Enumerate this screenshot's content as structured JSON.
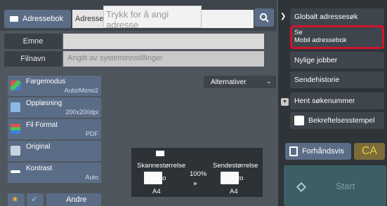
{
  "topbar": {
    "addressbook_label": "Adressebok",
    "address_tag": "Adresse",
    "address_placeholder": "Trykk for å angi adresse"
  },
  "fields": {
    "subject_label": "Emne",
    "filename_label": "Filnavn",
    "filename_placeholder": "Angitt av systeminnstillinger"
  },
  "options_label": "Alternativer",
  "settings": [
    {
      "title": "Fargemodus",
      "value": "Auto/Mono2",
      "icon": "color-mode-icon"
    },
    {
      "title": "Oppløsning",
      "value": "200x200dpi",
      "icon": "resolution-icon"
    },
    {
      "title": "Fil Format",
      "value": "PDF",
      "icon": "file-format-icon"
    },
    {
      "title": "Original",
      "value": "",
      "icon": "original-icon"
    },
    {
      "title": "Kontrast",
      "value": "Auto",
      "icon": "contrast-icon"
    }
  ],
  "bottom": {
    "other_label": "Andre"
  },
  "preview_panel": {
    "scan_size_label": "Skannestørrelse",
    "send_size_label": "Sendestørrelse",
    "scale": "100%",
    "scan_value": "Auto",
    "send_value": "Auto",
    "scan_paper": "A4",
    "send_paper": "A4"
  },
  "right_panel": {
    "global_search": "Globalt adressesøk",
    "mobile_line1": "Se",
    "mobile_line2": "Mobil adressebok",
    "recent_jobs": "Nylige jobber",
    "send_history": "Sendehistorie",
    "get_search_number": "Hent søkenummer",
    "confirmation_stamp": "Bekreftelsesstempel"
  },
  "actions": {
    "preview_label": "Forhåndsvis",
    "ca_label": "CA",
    "start_label": "Start"
  },
  "colors": {
    "accent_blue": "#5b6d86",
    "highlight_red": "#d3132c",
    "ca_yellow": "#e9c94a",
    "start_teal": "#3c5f66"
  }
}
